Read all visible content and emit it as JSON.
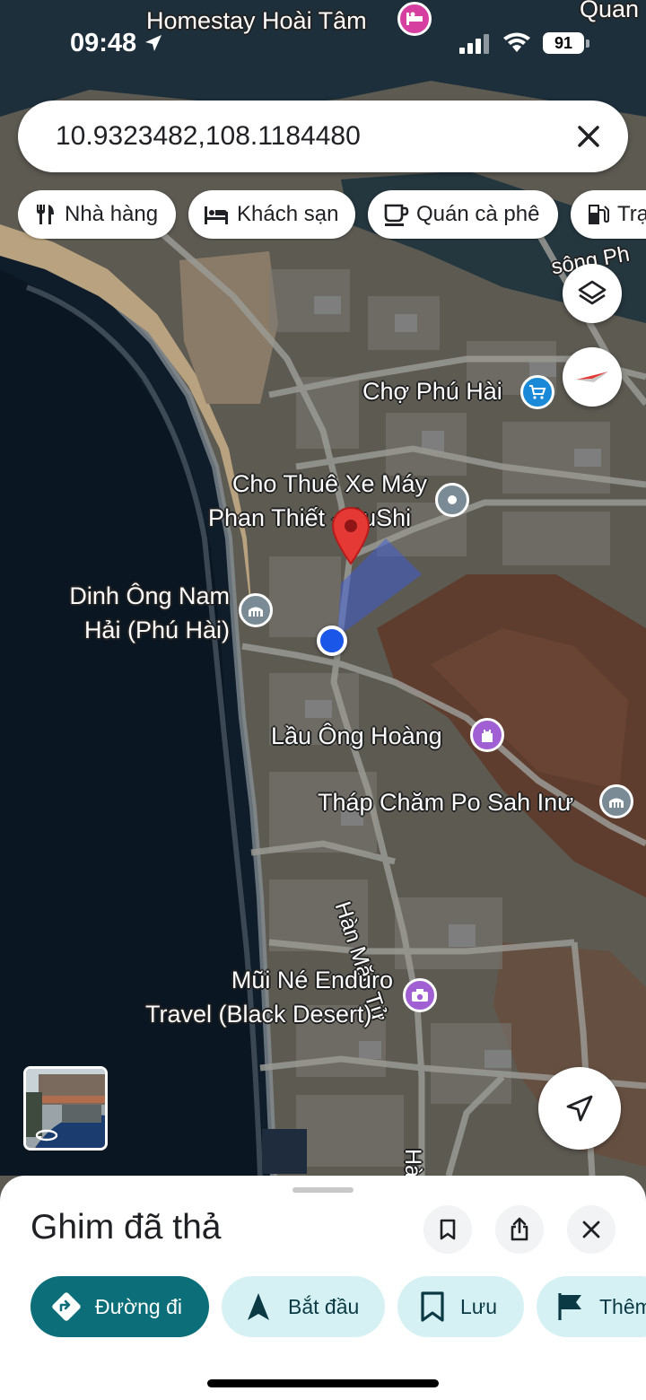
{
  "status_bar": {
    "time": "09:48",
    "battery": "91"
  },
  "search": {
    "value": "10.9323482,108.1184480"
  },
  "chips": [
    {
      "label": "Nhà hàng",
      "icon": "restaurant-icon"
    },
    {
      "label": "Khách sạn",
      "icon": "hotel-icon"
    },
    {
      "label": "Quán cà phê",
      "icon": "coffee-icon"
    },
    {
      "label": "Trạ",
      "icon": "gas-station-icon"
    }
  ],
  "map_labels": {
    "homestay": "Homestay Hoài Tâm",
    "quan": "Quan",
    "song": "sông Ph",
    "cho_phu_hai": "Chợ Phú Hài",
    "cho_thue_line1": "Cho Thuê Xe Máy",
    "cho_thue_line2": "Phan Thiết - SuShi",
    "dinh_line1": "Dinh Ông Nam",
    "dinh_line2": "Hải (Phú Hài)",
    "lau": "Lầu Ông Hoàng",
    "thap": "Tháp Chăm Po Sah Inư",
    "street": "Hàn Mặc Tử",
    "street_short": "Hà",
    "mui_ne_line1": "Mũi Né Enduro",
    "mui_ne_line2": "Travel (Black Desert)"
  },
  "colors": {
    "accent": "#0b6e78",
    "chip_bg": "#ffffff",
    "action_secondary": "#d6f1f4",
    "pin_red": "#e53935",
    "location_blue": "#1a56e8",
    "poi_pink": "#d63fa0",
    "poi_purple": "#a15fd4",
    "poi_blue": "#1a8ad8",
    "poi_gray": "#7b8b95"
  },
  "sheet": {
    "title": "Ghim đã thả",
    "actions": [
      {
        "label": "Đường đi",
        "icon": "directions-icon"
      },
      {
        "label": "Bắt đầu",
        "icon": "navigation-icon"
      },
      {
        "label": "Lưu",
        "icon": "bookmark-icon"
      },
      {
        "label": "Thêm",
        "icon": "flag-icon"
      }
    ]
  }
}
